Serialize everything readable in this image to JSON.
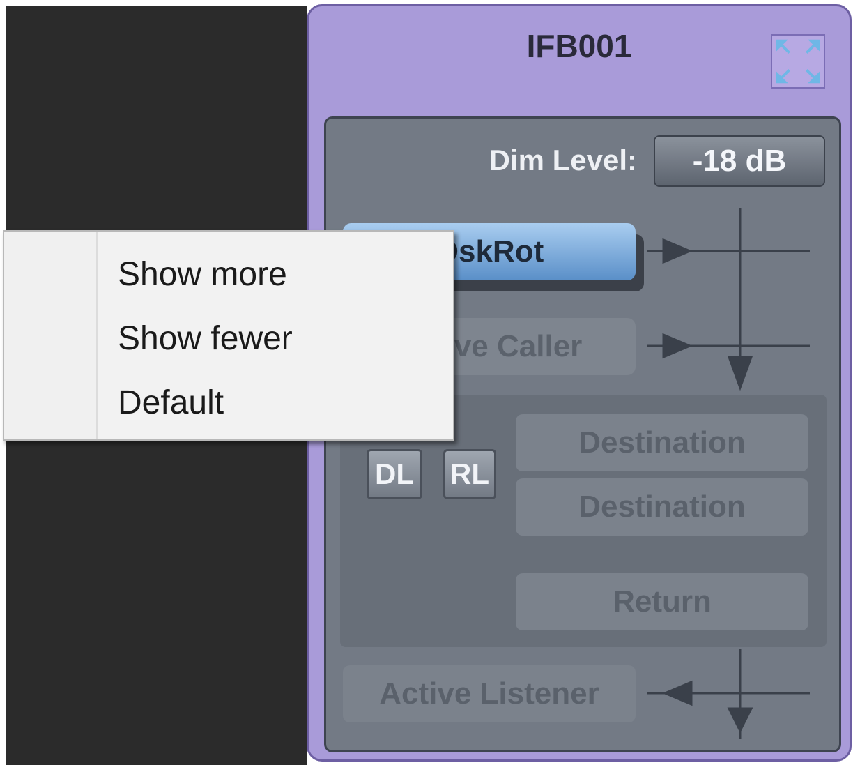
{
  "panel": {
    "title": "IFB001",
    "expand_icon": "expand-icon",
    "dim_level_label": "Dim Level:",
    "dim_level_value": "-18 dB",
    "source_active": "OskRot",
    "source_caller": "Active Caller",
    "tags": {
      "dl": "DL",
      "rl": "RL"
    },
    "destination_1": "Destination",
    "destination_2": "Destination",
    "return_label": "Return",
    "active_listener": "Active Listener"
  },
  "context_menu": {
    "items": [
      "Show more",
      "Show fewer",
      "Default"
    ]
  },
  "colors": {
    "panel_bg": "#a99bd9",
    "inner_bg": "#737a85",
    "active_button": "#6a9fd6",
    "menu_bg": "#f2f2f2"
  }
}
